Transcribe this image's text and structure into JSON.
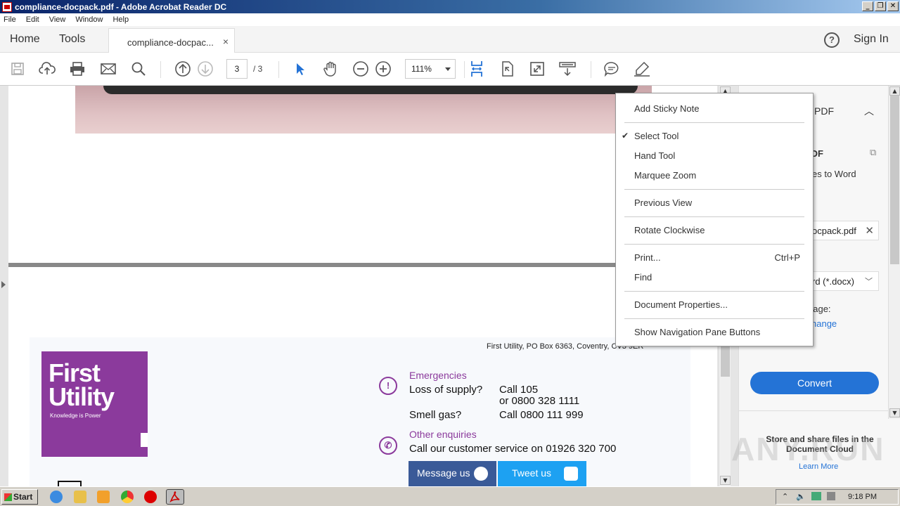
{
  "window": {
    "title": "compliance-docpack.pdf - Adobe Acrobat Reader DC",
    "buttons": [
      "_",
      "❐",
      "✕"
    ]
  },
  "menubar": [
    "File",
    "Edit",
    "View",
    "Window",
    "Help"
  ],
  "tabs": {
    "home": "Home",
    "tools": "Tools",
    "doc": "compliance-docpac...",
    "close": "×",
    "help": "?",
    "signin": "Sign In"
  },
  "toolbar": {
    "page_current": "3",
    "page_total": "/ 3",
    "zoom": "111%"
  },
  "document": {
    "address": "First Utility, PO Box 6363, Coventry, CV3 9ER",
    "logo_line1": "First",
    "logo_line2": "Utility",
    "logo_tag": "Knowledge is Power",
    "emergencies": "Emergencies",
    "loss_label": "Loss of supply?",
    "loss_call": "Call 105",
    "loss_alt": "or 0800 328 1111",
    "gas_label": "Smell gas?",
    "gas_call": "Call 0800 111 999",
    "other": "Other enquiries",
    "customer": "Call our customer service on 01926 320 700",
    "message_btn": "Message us",
    "tweet_btn": "Tweet us"
  },
  "right_panel": {
    "header": "PDF",
    "title": ": PDF",
    "subtitle": "es to Word",
    "file": "ocpack.pdf",
    "format": "rd (*.docx)",
    "language_label": "uage:",
    "change": "hange",
    "convert": "Convert",
    "cloud": "Store and share files in the Document Cloud",
    "learn": "Learn More"
  },
  "context_menu": {
    "items": [
      {
        "label": "Add Sticky Note"
      },
      {
        "label": "Select Tool",
        "checked": true
      },
      {
        "label": "Hand Tool"
      },
      {
        "label": "Marquee Zoom"
      },
      {
        "label": "Previous View"
      },
      {
        "label": "Rotate Clockwise"
      },
      {
        "label": "Print...",
        "shortcut": "Ctrl+P"
      },
      {
        "label": "Find"
      },
      {
        "label": "Document Properties..."
      },
      {
        "label": "Show Navigation Pane Buttons"
      }
    ],
    "check_mark": "✔"
  },
  "watermark": "ANY.RUN",
  "taskbar": {
    "start": "Start",
    "clock": "9:18 PM"
  },
  "colors": {
    "brand_purple": "#8b3a9c",
    "accent_blue": "#2473d6",
    "messenger": "#3a5a98",
    "twitter": "#1da1f2"
  }
}
